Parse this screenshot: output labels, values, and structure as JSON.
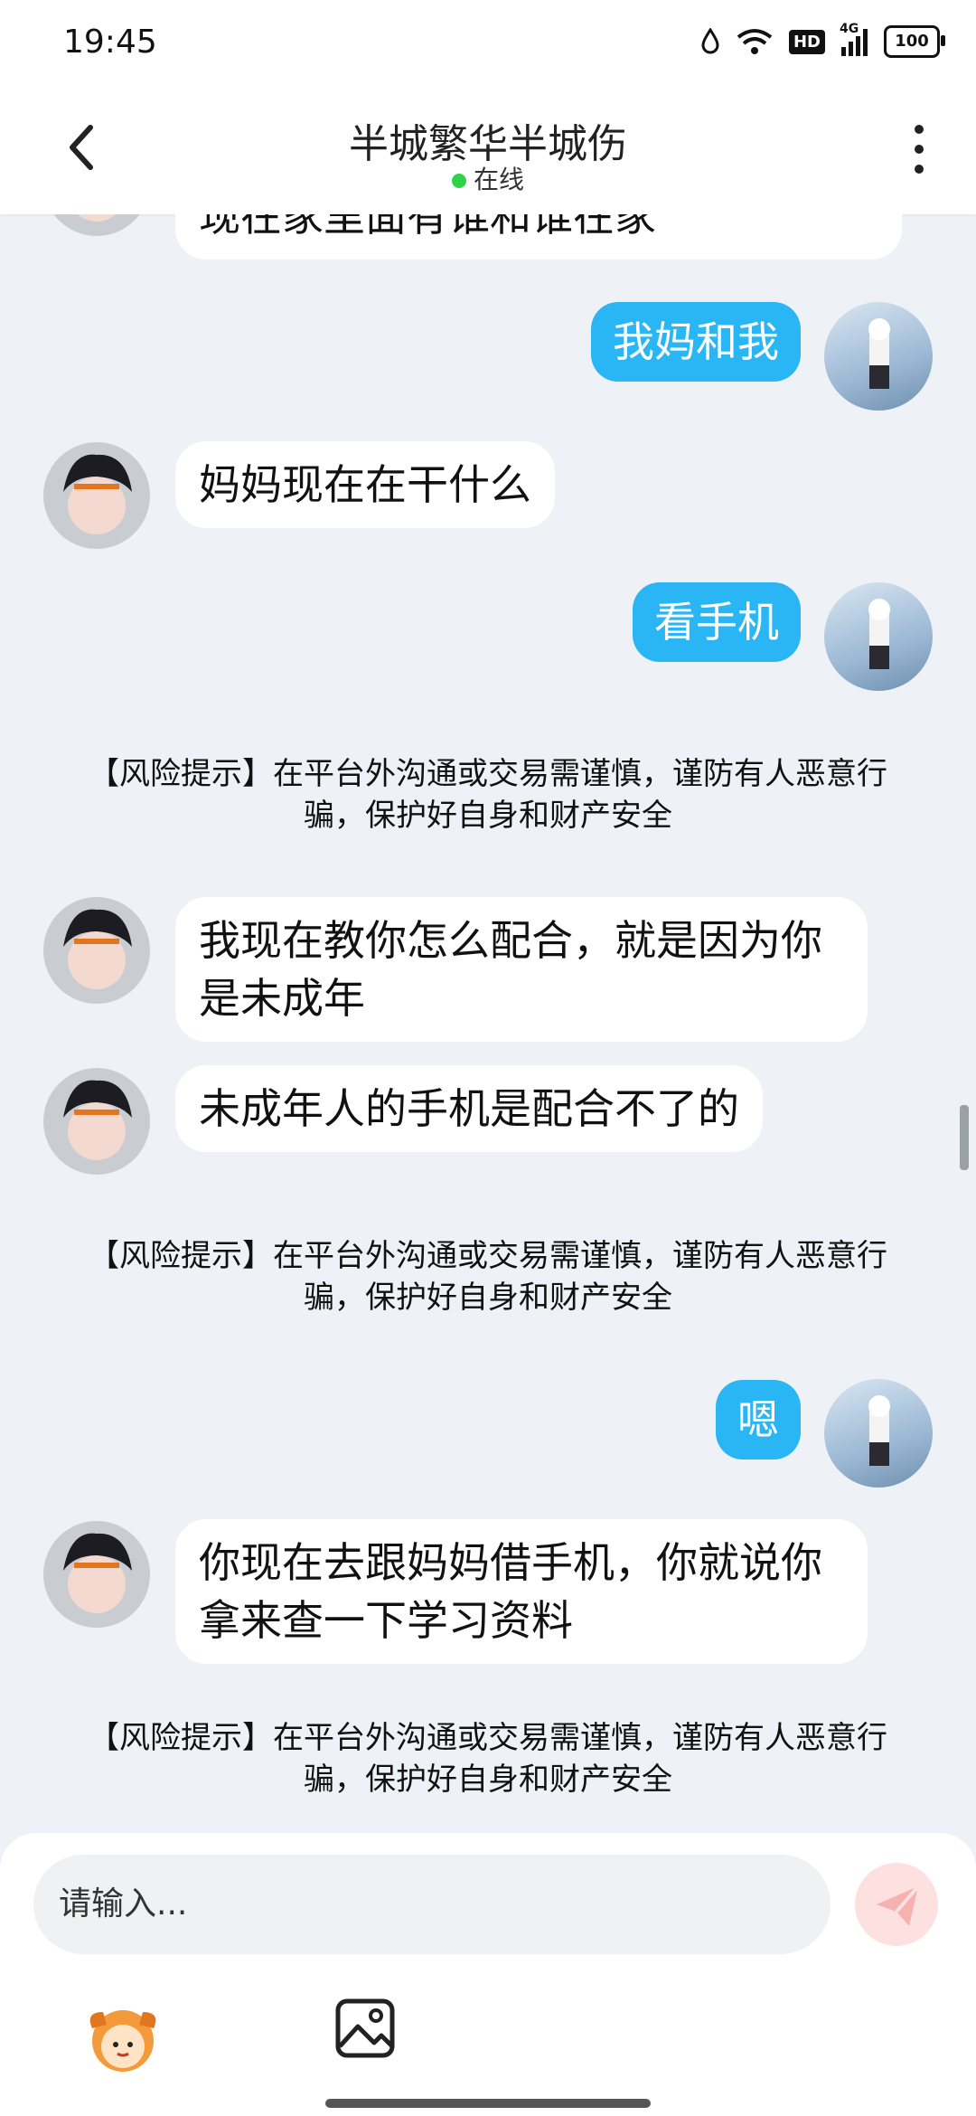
{
  "status_bar": {
    "time": "19:45",
    "battery": "100",
    "network": "4G",
    "hd": "HD"
  },
  "header": {
    "title": "半城繁华半城伤",
    "status": "在线"
  },
  "messages": [
    {
      "side": "left",
      "text": "现在家里面有谁和谁在家"
    },
    {
      "side": "right",
      "text": "我妈和我"
    },
    {
      "side": "left",
      "text": "妈妈现在在干什么"
    },
    {
      "side": "right",
      "text": "看手机"
    },
    {
      "side": "system",
      "text": "【风险提示】在平台外沟通或交易需谨慎，谨防有人恶意行骗，保护好自身和财产安全"
    },
    {
      "side": "left",
      "text": "我现在教你怎么配合，就是因为你是未成年"
    },
    {
      "side": "left",
      "text": "未成年人的手机是配合不了的"
    },
    {
      "side": "system",
      "text": "【风险提示】在平台外沟通或交易需谨慎，谨防有人恶意行骗，保护好自身和财产安全"
    },
    {
      "side": "right",
      "text": "嗯"
    },
    {
      "side": "left",
      "text": "你现在去跟妈妈借手机，你就说你拿来查一下学习资料"
    },
    {
      "side": "system",
      "text": "【风险提示】在平台外沟通或交易需谨慎，谨防有人恶意行骗，保护好自身和财产安全"
    }
  ],
  "input": {
    "placeholder": "请输入..."
  },
  "icons": {
    "back": "back-chevron-icon",
    "more": "more-vertical-icon",
    "send": "send-icon",
    "emoji": "emoji-mascot-icon",
    "image": "image-icon"
  },
  "colors": {
    "accent": "#2ab5f5",
    "online": "#2fd34a",
    "background": "#eef2f7"
  }
}
